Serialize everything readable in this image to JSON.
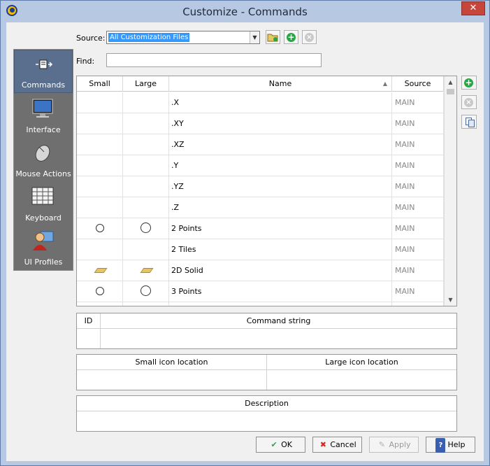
{
  "window": {
    "title": "Customize - Commands",
    "close_glyph": "✕"
  },
  "nav": {
    "items": [
      {
        "label": "Commands",
        "icon": "commands-icon"
      },
      {
        "label": "Interface",
        "icon": "monitor-icon"
      },
      {
        "label": "Mouse Actions",
        "icon": "mouse-icon"
      },
      {
        "label": "Keyboard",
        "icon": "keyboard-icon"
      },
      {
        "label": "UI Profiles",
        "icon": "user-profile-icon"
      }
    ]
  },
  "source": {
    "label": "Source:",
    "value": "All Customization Files"
  },
  "find": {
    "label": "Find:",
    "value": ""
  },
  "table": {
    "headers": {
      "small": "Small",
      "large": "Large",
      "name": "Name",
      "source": "Source"
    },
    "rows": [
      {
        "name": ".X",
        "source": "MAIN",
        "icon": ""
      },
      {
        "name": ".XY",
        "source": "MAIN",
        "icon": ""
      },
      {
        "name": ".XZ",
        "source": "MAIN",
        "icon": ""
      },
      {
        "name": ".Y",
        "source": "MAIN",
        "icon": ""
      },
      {
        "name": ".YZ",
        "source": "MAIN",
        "icon": ""
      },
      {
        "name": ".Z",
        "source": "MAIN",
        "icon": ""
      },
      {
        "name": "2 Points",
        "source": "MAIN",
        "icon": "circle-2points-icon"
      },
      {
        "name": "2 Tiles",
        "source": "MAIN",
        "icon": ""
      },
      {
        "name": "2D Solid",
        "source": "MAIN",
        "icon": "2d-solid-icon"
      },
      {
        "name": "3 Points",
        "source": "MAIN",
        "icon": "circle-3points-icon"
      }
    ]
  },
  "command_panel": {
    "id_header": "ID",
    "string_header": "Command string"
  },
  "icon_panel": {
    "small_header": "Small icon location",
    "large_header": "Large icon location"
  },
  "description_panel": {
    "header": "Description"
  },
  "buttons": {
    "ok": "OK",
    "cancel": "Cancel",
    "apply": "Apply",
    "help": "Help"
  },
  "colors": {
    "accent": "#3399ff",
    "nav_bg": "#6f6f6f",
    "nav_active": "#5a6e8e",
    "add_green": "#27a644"
  }
}
